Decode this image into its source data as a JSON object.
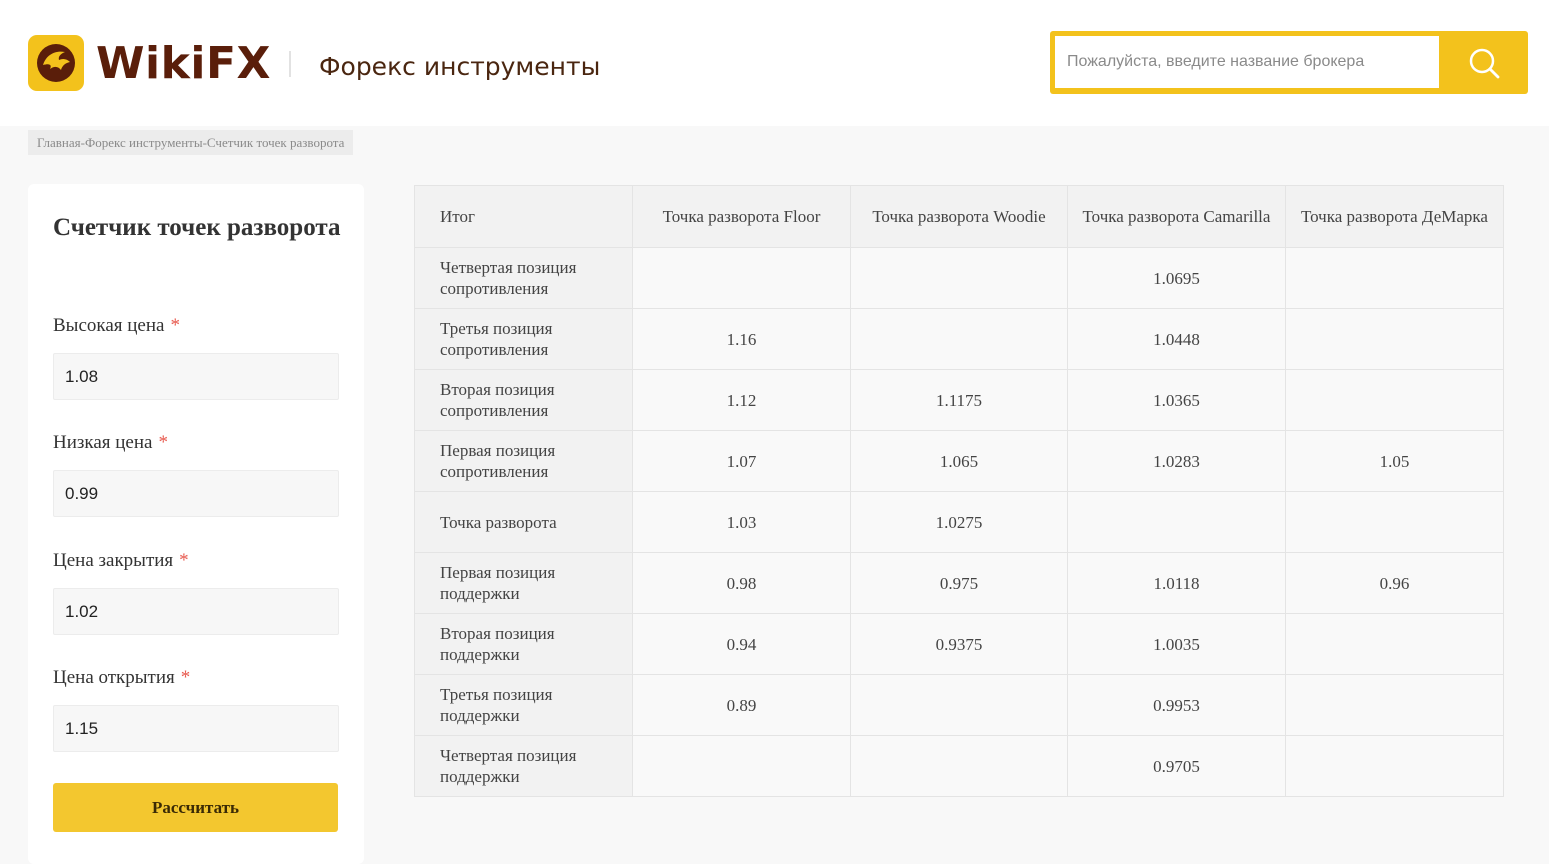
{
  "header": {
    "brand": "WikiFX",
    "section_title": "Форекс инструменты",
    "search_placeholder": "Пожалуйста, введите название брокера",
    "colors": {
      "accent": "#f3c21c",
      "brand_text": "#5a1e0a"
    }
  },
  "breadcrumb": "Главная-Форекс инструменты-Счетчик точек разворота",
  "form": {
    "title": "Счетчик точек разворота",
    "required_mark": "*",
    "fields": [
      {
        "label": "Высокая цена",
        "value": "1.08"
      },
      {
        "label": "Низкая цена",
        "value": "0.99"
      },
      {
        "label": "Цена закрытия",
        "value": "1.02"
      },
      {
        "label": "Цена открытия",
        "value": "1.15"
      }
    ],
    "submit_label": "Рассчитать"
  },
  "table": {
    "headers": [
      "Итог",
      "Точка разворота Floor",
      "Точка разворота Woodie",
      "Точка разворота Camarilla",
      "Точка разворота ДеМарка"
    ],
    "rows": [
      {
        "label": "Четвертая позиция сопротивления",
        "values": [
          "",
          "",
          "1.0695",
          ""
        ]
      },
      {
        "label": "Третья позиция сопротивления",
        "values": [
          "1.16",
          "",
          "1.0448",
          ""
        ]
      },
      {
        "label": "Вторая позиция сопротивления",
        "values": [
          "1.12",
          "1.1175",
          "1.0365",
          ""
        ]
      },
      {
        "label": "Первая позиция сопротивления",
        "values": [
          "1.07",
          "1.065",
          "1.0283",
          "1.05"
        ]
      },
      {
        "label": "Точка разворота",
        "values": [
          "1.03",
          "1.0275",
          "",
          ""
        ]
      },
      {
        "label": "Первая позиция поддержки",
        "values": [
          "0.98",
          "0.975",
          "1.0118",
          "0.96"
        ]
      },
      {
        "label": "Вторая позиция поддержки",
        "values": [
          "0.94",
          "0.9375",
          "1.0035",
          ""
        ]
      },
      {
        "label": "Третья позиция поддержки",
        "values": [
          "0.89",
          "",
          "0.9953",
          ""
        ]
      },
      {
        "label": "Четвертая позиция поддержки",
        "values": [
          "",
          "",
          "0.9705",
          ""
        ]
      }
    ]
  }
}
